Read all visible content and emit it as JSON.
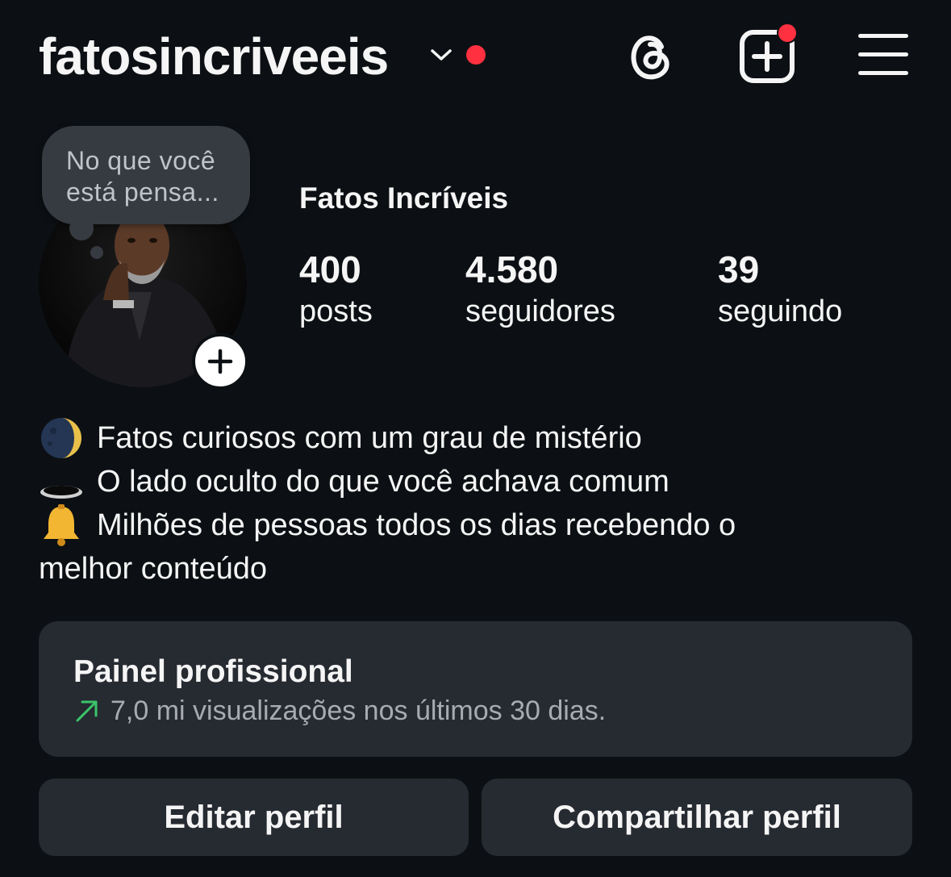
{
  "header": {
    "username": "fatosincriveeis",
    "icons": [
      "chevron-down-icon",
      "threads-icon",
      "create-post-icon",
      "menu-icon"
    ],
    "notification_color": "#ff3040"
  },
  "profile": {
    "note": "No que você está pensa...",
    "display_name": "Fatos Incríveis",
    "stats": [
      {
        "value": "400",
        "label": "posts"
      },
      {
        "value": "4.580",
        "label": "seguidores"
      },
      {
        "value": "39",
        "label": "seguindo"
      }
    ]
  },
  "bio": {
    "lines": [
      {
        "emoji": "moon-icon",
        "text": "Fatos curiosos com um grau de mistério"
      },
      {
        "emoji": "hole-icon",
        "text": "O lado oculto do que você achava comum"
      },
      {
        "emoji": "bell-icon",
        "text": "Milhões de pessoas todos os dias recebendo o"
      },
      {
        "emoji": "",
        "text": "melhor conteúdo"
      }
    ]
  },
  "professional_panel": {
    "title": "Painel profissional",
    "subtitle": "7,0 mi visualizações nos últimos 30 dias.",
    "trend_color": "#3ac569"
  },
  "buttons": {
    "edit": "Editar perfil",
    "share": "Compartilhar perfil"
  },
  "colors": {
    "background": "#0c1014",
    "surface": "#262a31",
    "text": "#f5f5f5"
  }
}
